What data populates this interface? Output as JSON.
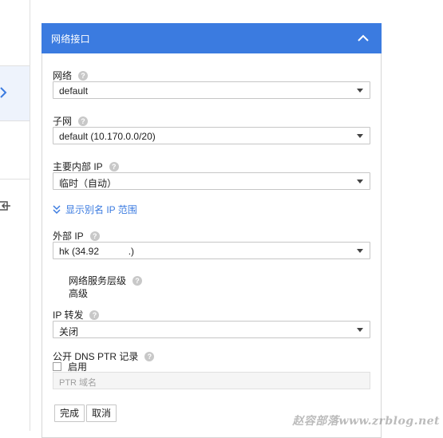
{
  "panel": {
    "title": "网络接口"
  },
  "fields": {
    "network": {
      "label": "网络",
      "value": "default"
    },
    "subnet": {
      "label": "子网",
      "value": "default (10.170.0.0/20)"
    },
    "internal_ip": {
      "label": "主要内部 IP",
      "value": "临时（自动）"
    },
    "alias_link": "显示别名 IP 范围",
    "external_ip": {
      "label": "外部 IP",
      "value": "hk (34.92           .)"
    },
    "network_tier": {
      "label": "网络服务层级",
      "value": "高级"
    },
    "ip_forwarding": {
      "label": "IP 转发",
      "value": "关闭"
    },
    "ptr": {
      "label": "公开 DNS PTR 记录",
      "checkbox_label": "启用",
      "placeholder": "PTR 域名"
    }
  },
  "buttons": {
    "done": "完成",
    "cancel": "取消"
  },
  "help_glyph": "?",
  "watermark": "赵容部落www.zrblog.net",
  "colors": {
    "header": "#3b7be0",
    "link": "#3b7be0"
  }
}
